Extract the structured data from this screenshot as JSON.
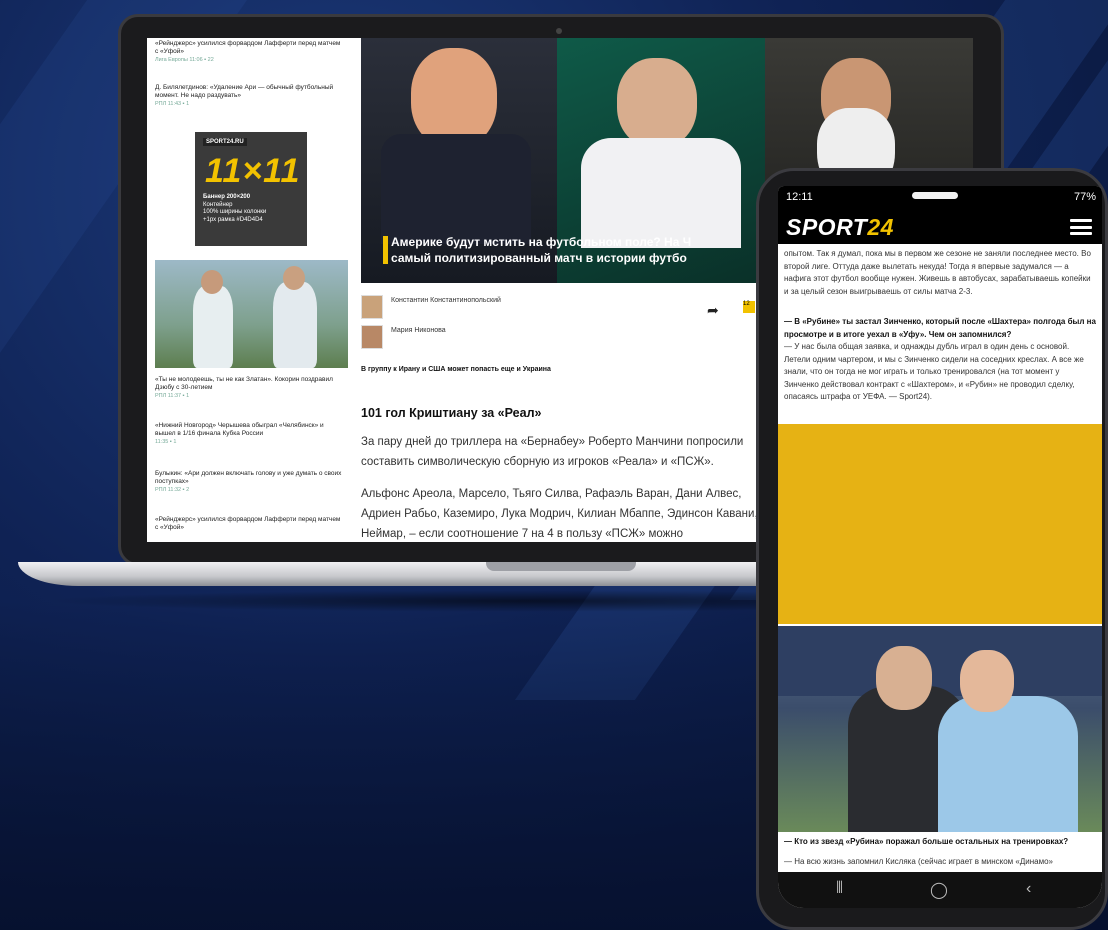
{
  "laptop": {
    "sidebar": {
      "items": [
        {
          "text": "«Рейнджерс» усилился форвардом Лафферти перед матчем с «Уфой»",
          "meta": "Лига Европы   11:06  ▪ 22"
        },
        {
          "text": "Д. Билялетдинов: «Удаление Ари — обычный футбольный момент. Не надо раздувать»",
          "meta": "РПЛ   11:43  ▪ 1"
        },
        {
          "text": "«Ты не молодеешь, ты не как Златан». Кокорин поздравил Дзюбу с 30-летием",
          "meta": "РПЛ   11:37  ▪ 1"
        },
        {
          "text": "«Нижний Новгород» Черышева обыграл «Челябинск» и вышел в 1/16 финала Кубка России",
          "meta": "11:35  ▪ 1"
        },
        {
          "text": "Булыкин: «Ари должен включать голову и уже думать о своих поступках»",
          "meta": "РПЛ   11:32  ▪ 2"
        },
        {
          "text": "«Рейнджерс» усилился форвардом Лафферти перед матчем с «Уфой»",
          "meta": ""
        }
      ],
      "banner": {
        "brand": "SPORT24.RU",
        "big": "11×11",
        "lines": [
          "Баннер 200×200",
          "Контейнер",
          "100% ширины колонки",
          "+1px рамка #D4D4D4"
        ]
      }
    },
    "hero": {
      "caption": "Америке будут мстить на футбольном поле? На Ч\nсамый политизированный матч в истории футбо"
    },
    "authors": [
      {
        "name": "Константин Константинопольский"
      },
      {
        "name": "Мария Никонова"
      }
    ],
    "tag": "12",
    "subheading": "В группу к Ирану и США может попасть еще и Украина",
    "article": {
      "title": "101 гол Криштиану за «Реал»",
      "p1": "За пару дней до триллера на «Бернабеу» Роберто Манчини попросили составить символическую сборную из игроков «Реала» и «ПСЖ».",
      "p2": "Альфонс Ареола, Марсело, Тьяго Силва, Рафаэль Варан, Дани Алвес, Адриен Рабьо, Каземиро, Лука Модрич, Килиан Мбаппе, Эдинсон Кавани, Неймар, – если соотношение 7 на 4 в пользу «ПСЖ» можно"
    }
  },
  "phone": {
    "status": {
      "time": "12:11",
      "battery": "77%"
    },
    "logo": {
      "main": "SPORT",
      "num": "24"
    },
    "para1": "опытом. Так я думал, пока мы в первом же сезоне не заняли последнее место. Во второй лиге. Оттуда даже вылетать некуда! Тогда я впервые задумался — а нафига этот футбол вообще нужен. Живешь в автобусах, зарабатываешь копейки и за целый сезон выигрываешь от силы матча 2-3.",
    "question1": "— В «Рубине» ты застал Зинченко, который после «Шахтера» полгода был на просмотре и в итоге уехал в «Уфу». Чем он запомнился?",
    "answer1": "— У нас была общая заявка, и однажды дубль играл в один день с основой. Летели одним чартером, и мы с Зинченко сидели на соседних креслах. А все же знали, что он тогда не мог играть и только тренировался (на тот момент у Зинченко действовал контракт с «Шахтером», и «Рубин» не проводил сделку, опасаясь штрафа от УЕФА. — Sport24).",
    "question2": "— Кто из звезд «Рубина» поражал больше остальных на тренировках?",
    "answer2": "— На всю жизнь запомнил Кисляка (сейчас играет в минском «Динамо»"
  }
}
